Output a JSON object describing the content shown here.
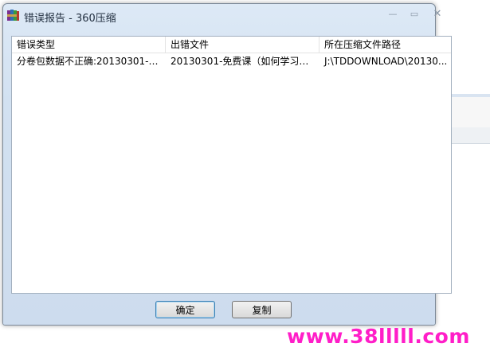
{
  "window": {
    "title": "错误报告 - 360压缩",
    "controls": {
      "minimize": "—",
      "maximize": "▭",
      "close": "✕"
    }
  },
  "table": {
    "headers": [
      "错误类型",
      "出错文件",
      "所在压缩文件路径"
    ],
    "rows": [
      [
        "分卷包数据不正确:20130301-免...",
        "20130301-免费课（如何学习液...",
        "J:\\TDDOWNLOAD\\20130..."
      ]
    ]
  },
  "buttons": {
    "ok": "确定",
    "copy": "复制"
  },
  "watermark": "www.38lllll.com",
  "colors": {
    "accent": "#3c7fb1",
    "watermark": "#ff1ec8"
  },
  "icons": {
    "app": "360-zip-icon"
  }
}
